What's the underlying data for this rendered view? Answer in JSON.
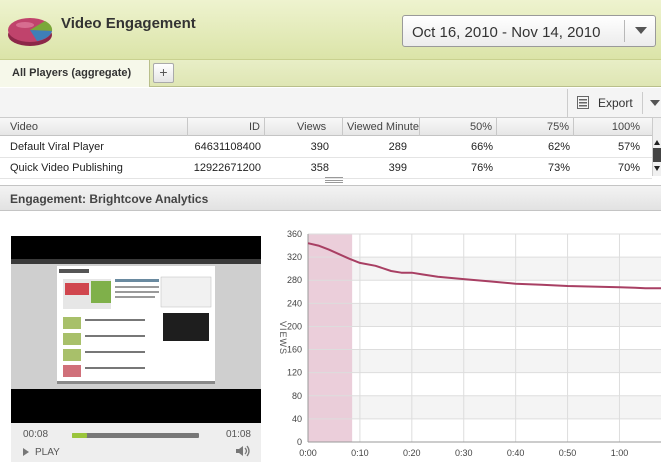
{
  "header": {
    "title": "Video Engagement",
    "date_range": "Oct 16, 2010 - Nov 14, 2010"
  },
  "tabs": [
    {
      "label": "All Players (aggregate)"
    }
  ],
  "tab_add_label": "+",
  "toolbar": {
    "export_label": "Export"
  },
  "table": {
    "columns": [
      "Video",
      "ID",
      "Views",
      "Viewed Minutes",
      "50%",
      "75%",
      "100%"
    ],
    "rows": [
      [
        "Default Viral Player",
        "64631108400",
        "390",
        "289",
        "66%",
        "62%",
        "57%"
      ],
      [
        "Quick Video Publishing",
        "12922671200",
        "358",
        "399",
        "76%",
        "73%",
        "70%"
      ]
    ]
  },
  "section": {
    "title": "Engagement: Brightcove Analytics"
  },
  "player": {
    "current_time": "00:08",
    "total_time": "01:08",
    "play_label": "PLAY",
    "progress": 0.12
  },
  "colors": {
    "header_bg": "#e4ebbd",
    "line": "#a83f63",
    "highlight": "#e8c6d3",
    "progress": "#9ac53b"
  },
  "chart_data": {
    "type": "line",
    "ylabel": "VIEWS",
    "ylim": [
      0,
      360
    ],
    "yticks": [
      0,
      40,
      80,
      120,
      160,
      200,
      240,
      280,
      320,
      360
    ],
    "xlim": [
      0,
      68
    ],
    "xticks": [
      {
        "v": 0,
        "label": "0:00"
      },
      {
        "v": 10,
        "label": "0:10"
      },
      {
        "v": 20,
        "label": "0:20"
      },
      {
        "v": 30,
        "label": "0:30"
      },
      {
        "v": 40,
        "label": "0:40"
      },
      {
        "v": 50,
        "label": "0:50"
      },
      {
        "v": 60,
        "label": "1:00"
      }
    ],
    "highlight_range": [
      0,
      8.5
    ],
    "series": [
      {
        "x": [
          0,
          2,
          4,
          6,
          8,
          10,
          13,
          16,
          18,
          20,
          22,
          25,
          30,
          35,
          40,
          45,
          50,
          55,
          60,
          63,
          65,
          68
        ],
        "values": [
          344,
          340,
          333,
          325,
          317,
          310,
          305,
          296,
          293,
          293,
          290,
          286,
          282,
          278,
          274,
          272,
          270,
          269,
          268,
          267,
          266,
          266
        ]
      }
    ]
  }
}
